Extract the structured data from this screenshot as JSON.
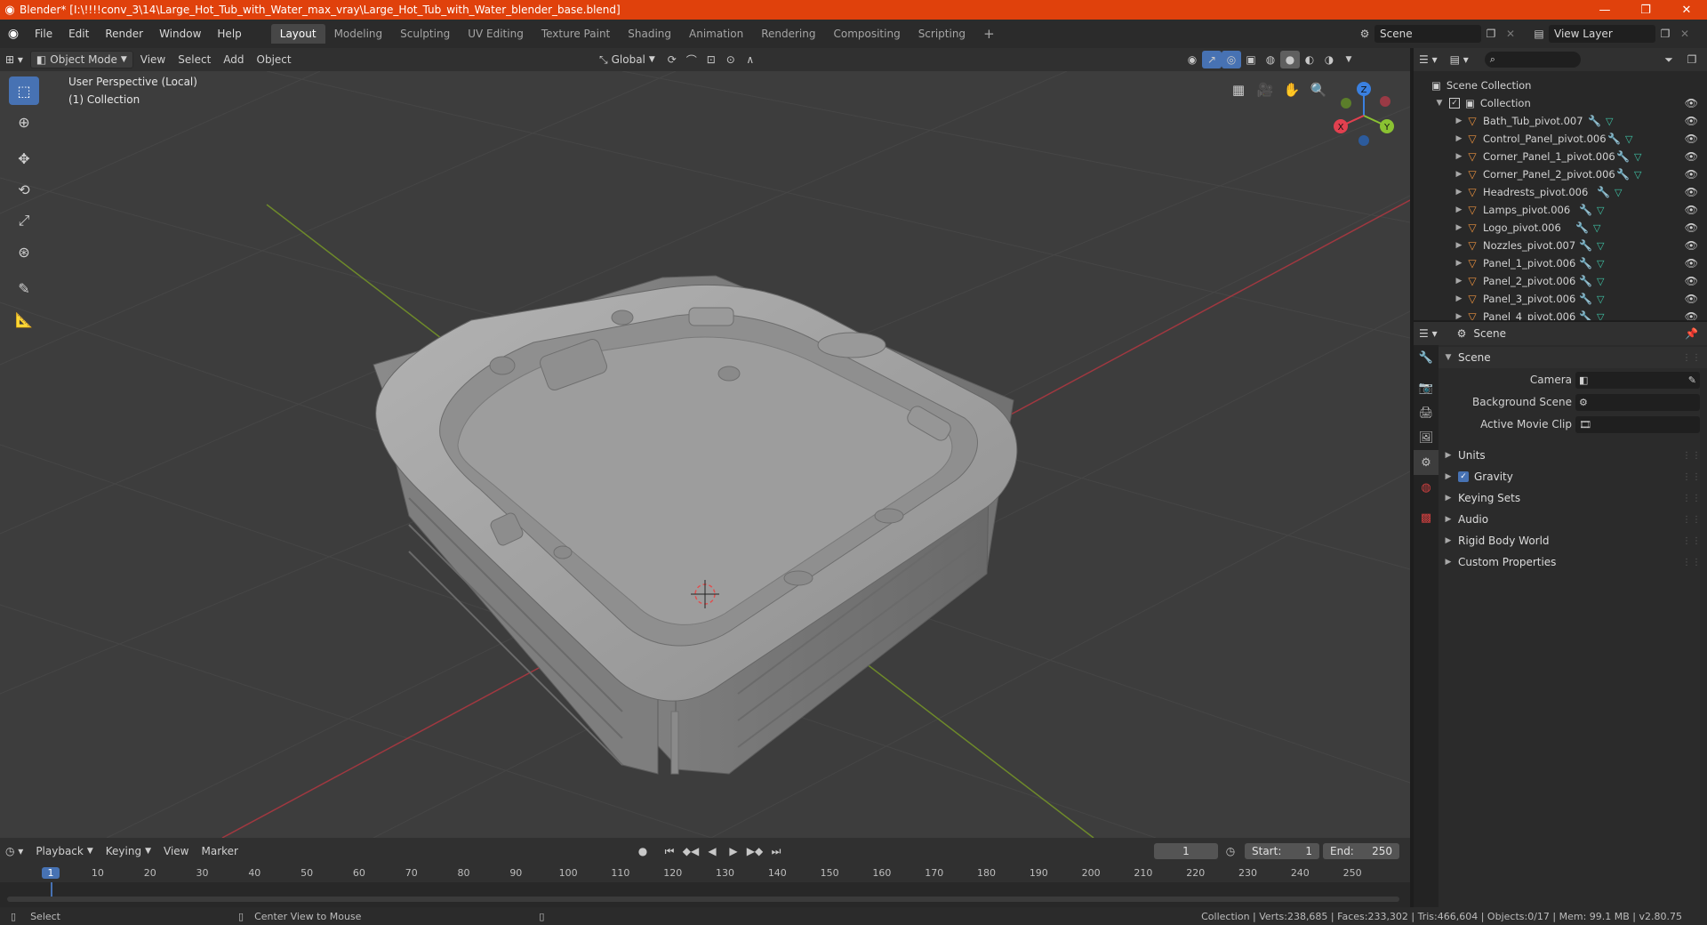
{
  "title_bar": {
    "title": "Blender* [I:\\!!!!conv_3\\14\\Large_Hot_Tub_with_Water_max_vray\\Large_Hot_Tub_with_Water_blender_base.blend]",
    "minimize": "—",
    "restore": "❐",
    "close": "✕"
  },
  "menu": {
    "items": [
      "File",
      "Edit",
      "Render",
      "Window",
      "Help"
    ],
    "workspaces": [
      "Layout",
      "Modeling",
      "Sculpting",
      "UV Editing",
      "Texture Paint",
      "Shading",
      "Animation",
      "Rendering",
      "Compositing",
      "Scripting"
    ],
    "add_workspace": "+",
    "scene_label": "Scene",
    "view_layer_label": "View Layer"
  },
  "viewport_header": {
    "mode": "Object Mode",
    "menus": [
      "View",
      "Select",
      "Add",
      "Object"
    ],
    "transform_orientation": "Global"
  },
  "viewport": {
    "perspective_label": "User Perspective (Local)",
    "collection_label": "(1) Collection",
    "gizmo_axes": {
      "x": "X",
      "y": "Y",
      "z": "Z"
    },
    "colors": {
      "x_axis": "#e2404f",
      "y_axis": "#8ac232",
      "z_axis": "#3a80e0",
      "background": "#3d3d3d"
    }
  },
  "timeline_header": {
    "menus": [
      "Playback",
      "Keying",
      "View",
      "Marker"
    ],
    "current_frame": "1",
    "start_label": "Start:",
    "start_value": "1",
    "end_label": "End:",
    "end_value": "250"
  },
  "timeline": {
    "ticks": [
      "1",
      "10",
      "20",
      "30",
      "40",
      "50",
      "60",
      "70",
      "80",
      "90",
      "100",
      "110",
      "120",
      "130",
      "140",
      "150",
      "160",
      "170",
      "180",
      "190",
      "200",
      "210",
      "220",
      "230",
      "240",
      "250"
    ],
    "current": "1"
  },
  "status_bar": {
    "left_action": "Select",
    "middle_action": "Center View to Mouse",
    "stats": "Collection | Verts:238,685 | Faces:233,302 | Tris:466,604 | Objects:0/17 | Mem: 99.1 MB | v2.80.75"
  },
  "outliner": {
    "search_placeholder": "",
    "scene_collection": "Scene Collection",
    "collection": "Collection",
    "objects": [
      "Bath_Tub_pivot.007",
      "Control_Panel_pivot.006",
      "Corner_Panel_1_pivot.006",
      "Corner_Panel_2_pivot.006",
      "Headrests_pivot.006",
      "Lamps_pivot.006",
      "Logo_pivot.006",
      "Nozzles_pivot.007",
      "Panel_1_pivot.006",
      "Panel_2_pivot.006",
      "Panel_3_pivot.006",
      "Panel_4_pivot.006"
    ]
  },
  "properties": {
    "header_title": "Scene",
    "panel_title": "Scene",
    "fields": [
      {
        "label": "Camera",
        "value": ""
      },
      {
        "label": "Background Scene",
        "value": ""
      },
      {
        "label": "Active Movie Clip",
        "value": ""
      }
    ],
    "sections": [
      "Units",
      "Gravity",
      "Keying Sets",
      "Audio",
      "Rigid Body World",
      "Custom Properties"
    ],
    "gravity_checked": true
  }
}
